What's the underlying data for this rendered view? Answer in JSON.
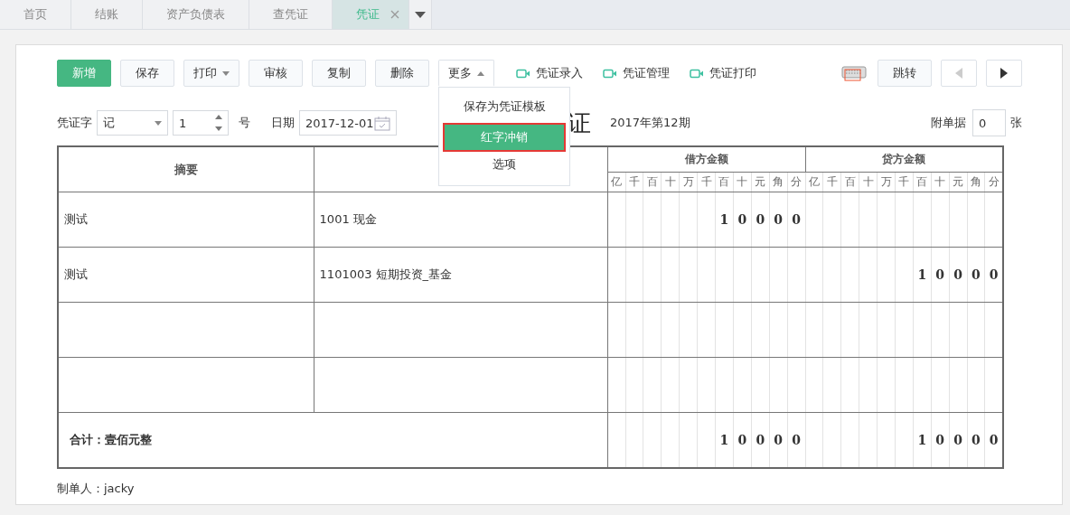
{
  "tabs": [
    {
      "label": "首页",
      "selected": false
    },
    {
      "label": "结账",
      "selected": false
    },
    {
      "label": "资产负债表",
      "selected": false
    },
    {
      "label": "查凭证",
      "selected": false
    },
    {
      "label": "凭证",
      "selected": true
    }
  ],
  "toolbar": {
    "buttons": [
      {
        "label": "新增",
        "kind": "primary"
      },
      {
        "label": "保存",
        "kind": "plain"
      },
      {
        "label": "打印",
        "kind": "caret-down"
      },
      {
        "label": "审核",
        "kind": "plain"
      },
      {
        "label": "复制",
        "kind": "plain"
      },
      {
        "label": "删除",
        "kind": "plain"
      },
      {
        "label": "更多",
        "kind": "caret-up",
        "expanded": true
      }
    ],
    "links": [
      "凭证录入",
      "凭证管理",
      "凭证打印"
    ],
    "jump_button": "跳转",
    "prev_disabled": true,
    "next_disabled": false
  },
  "more_menu": [
    {
      "label": "保存为凭证模板",
      "selected": false,
      "outlined": false
    },
    {
      "label": "红字冲销",
      "selected": true,
      "outlined": true
    },
    {
      "label": "选项",
      "selected": false,
      "outlined": false
    }
  ],
  "header": {
    "voucher_word_label": "凭证字",
    "voucher_word": "记",
    "number": "1",
    "number_suffix": "号",
    "date_label": "日期",
    "date": "2017-12-01",
    "title": "证",
    "period": "2017年第12期",
    "attachments_label": "附单据",
    "attachments": "0",
    "attachments_suffix": "张"
  },
  "table": {
    "columns": [
      "摘要"
    ],
    "debit_heading": "借方金额",
    "credit_heading": "贷方金额",
    "debit_units": [
      "亿",
      "千",
      "百",
      "十",
      "万",
      "千",
      "百",
      "十",
      "元",
      "角",
      "分"
    ],
    "credit_units": [
      "亿",
      "千",
      "百",
      "十",
      "万",
      "千",
      "百",
      "十",
      "元",
      "角",
      "分"
    ],
    "rows": [
      {
        "summary": "测试",
        "account": "1001 现金",
        "debit": [
          "1",
          "0",
          "0",
          "0",
          "0"
        ]
      },
      {
        "summary": "测试",
        "account": "1101003 短期投资_基金",
        "credit": [
          "1",
          "0",
          "0",
          "0",
          "0"
        ]
      },
      {},
      {}
    ],
    "total": {
      "label": "合计：壹佰元整",
      "debit": [
        "1",
        "0",
        "0",
        "0",
        "0"
      ],
      "credit": [
        "1",
        "0",
        "0",
        "0",
        "0"
      ]
    }
  },
  "footer": "制单人：jacky"
}
